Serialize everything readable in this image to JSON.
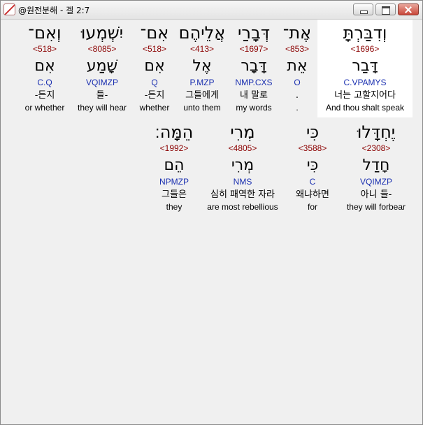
{
  "window": {
    "title": "@원전분해 - 겔 2:7"
  },
  "row1": [
    {
      "hebrew": "וְדִבַּרְתָּ",
      "strong": "<1696>",
      "root": "דָּבַר",
      "morph": "C.VPAMYS",
      "korean": "너는 고할지어다",
      "english": "And thou shalt speak"
    },
    {
      "hebrew": "אֶת־",
      "strong": "<853>",
      "root": "אֵת",
      "morph": "O",
      "korean": ".",
      "english": "."
    },
    {
      "hebrew": "דְּבָרַי",
      "strong": "<1697>",
      "root": "דָּבָר",
      "morph": "NMP.CXS",
      "korean": "내 말로",
      "english": "my words"
    },
    {
      "hebrew": "אֲלֵיהֶם",
      "strong": "<413>",
      "root": "אֶל",
      "morph": "P.MZP",
      "korean": "그들에게",
      "english": "unto them"
    },
    {
      "hebrew": "אִם־",
      "strong": "<518>",
      "root": "אִם",
      "morph": "Q",
      "korean": "-든지",
      "english": "whether"
    },
    {
      "hebrew": "יִשְׁמְעוּ",
      "strong": "<8085>",
      "root": "שָׁמַע",
      "morph": "VQIMZP",
      "korean": "들-",
      "english": "they will hear"
    },
    {
      "hebrew": "וְאִם־",
      "strong": "<518>",
      "root": "אִם",
      "morph": "C.Q",
      "korean": "-든지",
      "english": "or whether"
    }
  ],
  "row2": [
    {
      "hebrew": "יֶחְדָּלוּ",
      "strong": "<2308>",
      "root": "חָדַל",
      "morph": "VQIMZP",
      "korean": "아니 들-",
      "english": "they will forbear"
    },
    {
      "hebrew": "כִּי",
      "strong": "<3588>",
      "root": "כִּי",
      "morph": "C",
      "korean": "왜냐하면",
      "english": "for"
    },
    {
      "hebrew": "מְרִי",
      "strong": "<4805>",
      "root": "מְרִי",
      "morph": "NMS",
      "korean": "심히 패역한 자라",
      "english": "are most rebellious"
    },
    {
      "hebrew": "הֵמָּה׃",
      "strong": "<1992>",
      "root": "הֵם",
      "morph": "NPMZP",
      "korean": "그들은",
      "english": "they"
    }
  ],
  "selected_word": "row1.0",
  "colors": {
    "strong": "#8b0000",
    "morph": "#1a2fb0",
    "selected_bg": "#ffffff",
    "close_button": "#c9473a"
  }
}
